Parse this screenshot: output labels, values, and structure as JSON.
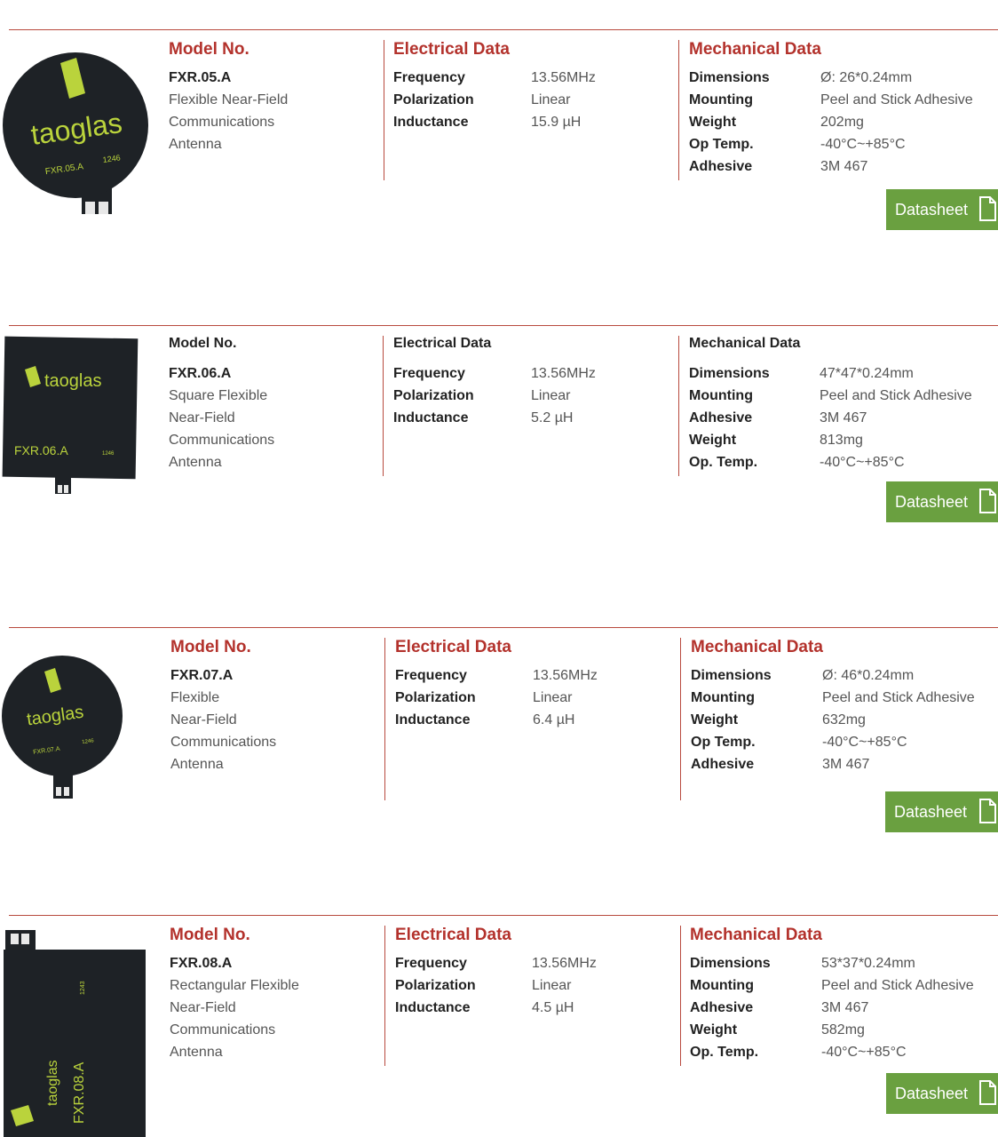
{
  "products": [
    {
      "heading_style": "red",
      "model_heading": "Model No.",
      "model": "FXR.05.A",
      "description": [
        "Flexible Near-Field",
        "Communications",
        "Antenna"
      ],
      "electrical_heading": "Electrical Data",
      "electrical": [
        {
          "k": "Frequency",
          "v": "13.56MHz"
        },
        {
          "k": "Polarization",
          "v": "Linear"
        },
        {
          "k": "Inductance",
          "v": "15.9 µH"
        }
      ],
      "mechanical_heading": "Mechanical Data",
      "mechanical": [
        {
          "k": "Dimensions",
          "v": "Ø: 26*0.24mm"
        },
        {
          "k": "Mounting",
          "v": "Peel and Stick Adhesive"
        },
        {
          "k": "Weight",
          "v": "202mg"
        },
        {
          "k": "Op Temp.",
          "v": "-40°C~+85°C"
        },
        {
          "k": "Adhesive",
          "v": "3M 467"
        }
      ],
      "datasheet_label": "Datasheet",
      "image": {
        "brand": "taoglas",
        "part": "FXR.05.A",
        "code": "1246"
      }
    },
    {
      "heading_style": "dark",
      "model_heading": "Model No.",
      "model": "FXR.06.A",
      "description": [
        "Square Flexible",
        "Near-Field",
        "Communications",
        "Antenna"
      ],
      "electrical_heading": "Electrical Data",
      "electrical": [
        {
          "k": "Frequency",
          "v": "13.56MHz"
        },
        {
          "k": "Polarization",
          "v": "Linear"
        },
        {
          "k": "Inductance",
          "v": "5.2 µH"
        }
      ],
      "mechanical_heading": "Mechanical Data",
      "mechanical": [
        {
          "k": "Dimensions",
          "v": "47*47*0.24mm"
        },
        {
          "k": "Mounting",
          "v": "Peel and Stick Adhesive"
        },
        {
          "k": "Adhesive",
          "v": "3M 467"
        },
        {
          "k": "Weight",
          "v": "813mg"
        },
        {
          "k": "Op. Temp.",
          "v": "-40°C~+85°C"
        }
      ],
      "datasheet_label": "Datasheet",
      "image": {
        "brand": "taoglas",
        "part": "FXR.06.A",
        "code": "1246"
      }
    },
    {
      "heading_style": "red",
      "model_heading": "Model No.",
      "model": "FXR.07.A",
      "description": [
        "Flexible",
        "Near-Field",
        "Communications",
        "Antenna"
      ],
      "electrical_heading": "Electrical Data",
      "electrical": [
        {
          "k": "Frequency",
          "v": "13.56MHz"
        },
        {
          "k": "Polarization",
          "v": "Linear"
        },
        {
          "k": "Inductance",
          "v": "6.4 µH"
        }
      ],
      "mechanical_heading": "Mechanical Data",
      "mechanical": [
        {
          "k": "Dimensions",
          "v": "Ø:  46*0.24mm"
        },
        {
          "k": "Mounting",
          "v": "Peel and Stick Adhesive"
        },
        {
          "k": "Weight",
          "v": "632mg"
        },
        {
          "k": "Op Temp.",
          "v": "-40°C~+85°C"
        },
        {
          "k": "Adhesive",
          "v": "3M 467"
        }
      ],
      "datasheet_label": "Datasheet",
      "image": {
        "brand": "taoglas",
        "part": "FXR.07.A",
        "code": "1246"
      }
    },
    {
      "heading_style": "red",
      "model_heading": "Model No.",
      "model": "FXR.08.A",
      "description": [
        "Rectangular Flexible",
        "Near-Field",
        "Communications",
        "Antenna"
      ],
      "electrical_heading": "Electrical Data",
      "electrical": [
        {
          "k": "Frequency",
          "v": "13.56MHz"
        },
        {
          "k": "Polarization",
          "v": "Linear"
        },
        {
          "k": "Inductance",
          "v": "4.5 µH"
        }
      ],
      "mechanical_heading": "Mechanical Data",
      "mechanical": [
        {
          "k": "Dimensions",
          "v": "53*37*0.24mm"
        },
        {
          "k": "Mounting",
          "v": "Peel and Stick Adhesive"
        },
        {
          "k": "Adhesive",
          "v": "3M 467"
        },
        {
          "k": "Weight",
          "v": "582mg"
        },
        {
          "k": "Op. Temp.",
          "v": "-40°C~+85°C"
        }
      ],
      "datasheet_label": "Datasheet",
      "image": {
        "brand": "taoglas",
        "part": "FXR.08.A",
        "code": "1243"
      }
    }
  ],
  "colors": {
    "accent_red": "#b3322c",
    "rule": "#b84a3e",
    "button_green": "#6aa040",
    "antenna_body": "#1e2226",
    "logo_green": "#bad33c"
  }
}
